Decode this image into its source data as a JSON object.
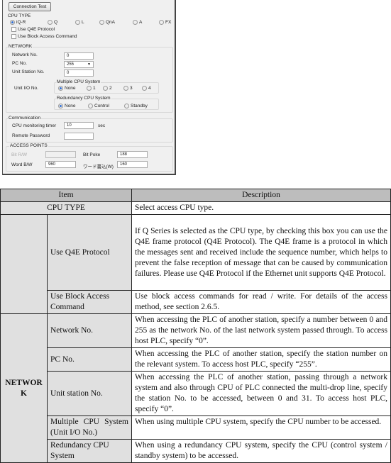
{
  "dialog": {
    "connection_test": "Connection Test",
    "cpu_type": {
      "label": "CPU TYPE",
      "options": [
        "iQ-R",
        "Q",
        "L",
        "QnA",
        "A",
        "FX"
      ],
      "selected": "iQ-R",
      "use_q4e": "Use Q4E Protocol",
      "use_block": "Use Block Access Command"
    },
    "network": {
      "label": "NETWORK",
      "network_no_label": "Network No.",
      "network_no": "0",
      "pc_no_label": "PC No.",
      "pc_no": "255",
      "unit_station_label": "Unit Station No.",
      "unit_station": "0",
      "unit_io_label": "Unit I/O No.",
      "multi_cpu_label": "Multiple CPU System",
      "multi_options": [
        "None",
        "1",
        "2",
        "3",
        "4"
      ],
      "redundancy_label": "Redundancy CPU System",
      "redundancy_options": [
        "None",
        "Control",
        "Standby"
      ]
    },
    "communication": {
      "label": "Communication",
      "timer_label": "CPU monitoring timer",
      "timer": "10",
      "timer_unit": "sec",
      "password_label": "Remote Password",
      "password": ""
    },
    "access_points": {
      "label": "ACCESS POINTS",
      "bit_rw_label": "Bit R/W",
      "bit_rw": "",
      "bit_poke_label": "Bit Poke",
      "bit_poke": "188",
      "word_bw_label": "Word B/W",
      "word_bw": "960",
      "word_write_label": "ワード書込(W)",
      "word_write": "160"
    }
  },
  "table": {
    "headers": [
      "Item",
      "Description"
    ],
    "cpu_type": {
      "label": "CPU TYPE",
      "desc": "Select access CPU type."
    },
    "use_q4e": {
      "label": "Use Q4E Protocol",
      "desc": "If Q Series is selected as the CPU type, by checking this box you can use the Q4E frame protocol (Q4E Protocol). The Q4E frame is a protocol in which the messages sent and received include the sequence number, which helps to prevent the false reception of message that can be caused by communication failures. Please use Q4E Protocol if the Ethernet unit supports Q4E Protocol."
    },
    "use_block": {
      "label": "Use Block Access Command",
      "desc": "Use block access commands for read / write. For details of the access method, see section 2.6.5."
    },
    "network_group": "NETWORK",
    "network_no": {
      "label": "Network No.",
      "desc": "When accessing the PLC of another station, specify a number between 0 and 255 as the network No. of the last network system passed through. To access host PLC, specify “0”."
    },
    "pc_no": {
      "label": "PC No.",
      "desc": "When accessing the PLC of another station, specify the station number on the relevant system. To access host PLC, specify “255”."
    },
    "unit_station": {
      "label": "Unit station No.",
      "desc": "When accessing the PLC of another station, passing through a network system and also through CPU of PLC connected the multi-drop line, specify the station No. to be accessed, between 0 and 31. To access host PLC, specify “0”."
    },
    "multi_cpu": {
      "label": "Multiple CPU System (Unit I/O No.)",
      "desc": "When using multiple CPU system, specify the CPU number to be accessed."
    },
    "redundancy": {
      "label": "Redundancy CPU System",
      "desc": "When using a redundancy CPU system, specify the CPU (control system / standby system) to be accessed."
    }
  }
}
